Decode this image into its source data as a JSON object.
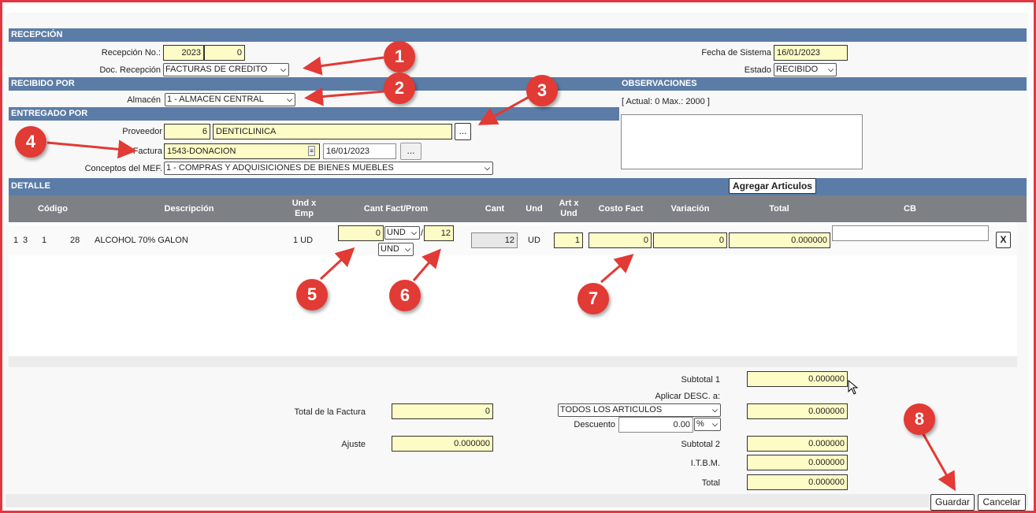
{
  "sections": {
    "recepcion": "RECEPCIÓN",
    "recibido_por": "RECIBIDO POR",
    "entregado_por": "ENTREGADO POR",
    "observaciones": "OBSERVACIONES",
    "detalle": "DETALLE"
  },
  "recepcion": {
    "no_label": "Recepción No.:",
    "no_year": "2023",
    "no_num": "0",
    "doc_label": "Doc. Recepción",
    "doc_value": "FACTURAS DE CREDITO",
    "fecha_label": "Fecha de Sistema",
    "fecha_value": "16/01/2023",
    "estado_label": "Estado",
    "estado_value": "RECIBIDO"
  },
  "recibido": {
    "almacen_label": "Almacén",
    "almacen_value": "1 - ALMACEN CENTRAL"
  },
  "observaciones": {
    "counter": "[ Actual: 0   Max.: 2000 ]"
  },
  "entregado": {
    "proveedor_label": "Proveedor",
    "proveedor_id": "6",
    "proveedor_name": "DENTICLINICA",
    "lookup_label": "...",
    "factura_label": "Factura",
    "factura_value": "1543-DONACION",
    "factura_fecha": "16/01/2023",
    "fecha_btn": "...",
    "conceptos_label": "Conceptos del MEF.",
    "conceptos_value": "1 - COMPRAS Y ADQUISICIONES DE BIENES MUEBLES"
  },
  "detalle": {
    "add_button": "Agregar Articulos",
    "columns": {
      "codigo": "Código",
      "descripcion": "Descripción",
      "und_emp": "Und x Emp",
      "cant_fact": "Cant Fact/Prom",
      "cant": "Cant",
      "und": "Und",
      "art_und": "Art x Und",
      "costo": "Costo Fact",
      "variacion": "Variación",
      "total": "Total",
      "cb": "CB"
    },
    "row": {
      "c1": "1",
      "c2": "3",
      "c3": "1",
      "codigo": "28",
      "descripcion": "ALCOHOL 70% GALON",
      "und_emp": "1 UD",
      "cant_fact": "0",
      "und_sel1": "UND",
      "slash": "/",
      "prom": "12",
      "und_sel2": "UND",
      "cant": "12",
      "und": "UD",
      "art_und": "1",
      "costo": "0",
      "variacion": "0",
      "total": "0.000000",
      "cb": "",
      "delete": "X"
    }
  },
  "totals": {
    "total_factura_label": "Total de la Factura",
    "total_factura": "0",
    "ajuste_label": "Ajuste",
    "ajuste": "0.000000",
    "subtotal1_label": "Subtotal 1",
    "subtotal1": "0.000000",
    "aplicar_label": "Aplicar DESC. a:",
    "aplicar_value": "TODOS LOS ARTICULOS",
    "desc_amount": "0.000000",
    "descuento_label": "Descuento",
    "descuento_value": "0.00",
    "descuento_unit": "%",
    "subtotal2_label": "Subtotal 2",
    "subtotal2": "0.000000",
    "itbm_label": "I.T.B.M.",
    "itbm": "0.000000",
    "total_label": "Total",
    "total": "0.000000"
  },
  "actions": {
    "guardar": "Guardar",
    "cancelar": "Cancelar"
  },
  "annotations": [
    "1",
    "2",
    "3",
    "4",
    "5",
    "6",
    "7",
    "8"
  ],
  "colors": {
    "section_bar": "#5b7ca6",
    "table_header": "#7d8085",
    "field_bg": "#fdfcc6",
    "annotation": "#e23a34",
    "frame": "#e0383e"
  }
}
